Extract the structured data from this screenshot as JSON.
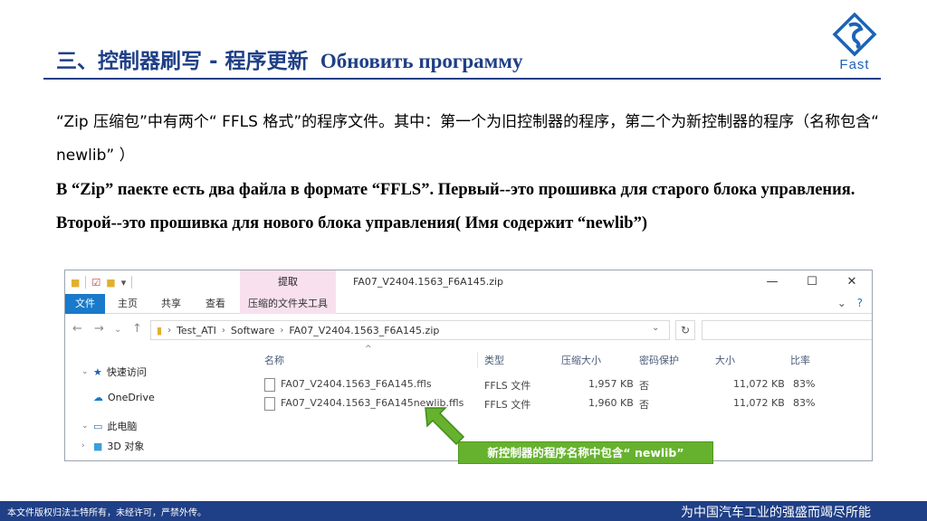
{
  "slide": {
    "title_cn": "三、控制器刷写 -  程序更新",
    "title_ru": "Обновить программу",
    "logo_text": "Fast",
    "para_cn": "“Zip 压缩包”中有两个“ FFLS 格式”的程序文件。其中：第一个为旧控制器的程序，第二个为新控制器的程序（名称包含“ newlib” ）",
    "para_ru": "В “Zip” паекте есть два файла в формате “FFLS”. Первый--это прошивка для старого блока управления. Второй--это прошивка для нового блока управления( Имя содержит “newlib”)",
    "footer_left": "本文件版权归法士特所有，未经许可，严禁外传。",
    "footer_right": "为中国汽车工业的强盛而竭尽所能"
  },
  "explorer": {
    "extract_tab": "提取",
    "window_title": "FA07_V2404.1563_F6A145.zip",
    "ribbon": {
      "file": "文件",
      "home": "主页",
      "share": "共享",
      "view": "查看",
      "tools": "压缩的文件夹工具"
    },
    "address": [
      "Test_ATI",
      "Software",
      "FA07_V2404.1563_F6A145.zip"
    ],
    "nav": {
      "quick_access": "快速访问",
      "onedrive": "OneDrive",
      "this_pc": "此电脑",
      "objects3d": "3D 对象"
    },
    "columns": {
      "name": "名称",
      "type": "类型",
      "compressed": "压缩大小",
      "password": "密码保护",
      "size": "大小",
      "ratio": "比率"
    },
    "files": [
      {
        "name": "FA07_V2404.1563_F6A145.ffls",
        "type": "FFLS 文件",
        "compressed": "1,957 KB",
        "password": "否",
        "size": "11,072 KB",
        "ratio": "83%"
      },
      {
        "name": "FA07_V2404.1563_F6A145newlib.ffls",
        "type": "FFLS 文件",
        "compressed": "1,960 KB",
        "password": "否",
        "size": "11,072 KB",
        "ratio": "83%"
      }
    ]
  },
  "callout": {
    "text": "新控制器的程序名称中包含“ newlib”",
    "color": "#66b22e"
  },
  "colors": {
    "brand_blue": "#1f3f86",
    "logo_blue": "#1b63b7",
    "ribbon_blue": "#1979ca",
    "tools_pink": "#f8e0ee"
  }
}
